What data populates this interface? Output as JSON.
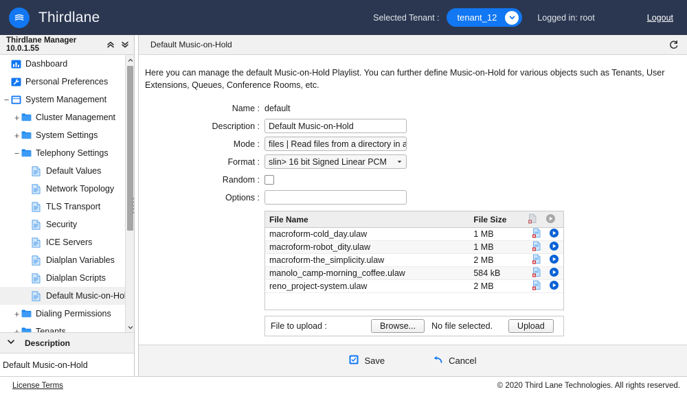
{
  "topbar": {
    "brand": "Thirdlane",
    "logo_icon": "thirdlane-waves-icon",
    "tenant_label": "Selected Tenant :",
    "tenant_value": "tenant_12",
    "tenant_caret_icon": "chevron-down-icon",
    "logged_in": "Logged in: root",
    "logout": "Logout",
    "bg_color": "#2b3750",
    "accent_color": "#1277f2"
  },
  "sidebar": {
    "title": "Thirdlane Manager 10.0.1.55",
    "collapse_all_icon": "double-chevron-up-icon",
    "expand_all_icon": "double-chevron-down-icon",
    "scroll_up_icon": "chevron-up-icon",
    "scroll_down_icon": "chevron-down-icon",
    "items": [
      {
        "label": "Dashboard",
        "icon": "dashboard-icon",
        "indent": 0,
        "twisty": "",
        "selected": false
      },
      {
        "label": "Personal Preferences",
        "icon": "wrench-icon",
        "indent": 0,
        "twisty": "",
        "selected": false
      },
      {
        "label": "System Management",
        "icon": "window-icon",
        "indent": 0,
        "twisty": "minus",
        "selected": false
      },
      {
        "label": "Cluster Management",
        "icon": "folder-icon",
        "indent": 1,
        "twisty": "plus",
        "selected": false
      },
      {
        "label": "System Settings",
        "icon": "folder-icon",
        "indent": 1,
        "twisty": "plus",
        "selected": false
      },
      {
        "label": "Telephony Settings",
        "icon": "folder-icon",
        "indent": 1,
        "twisty": "minus",
        "selected": false
      },
      {
        "label": "Default Values",
        "icon": "page-icon",
        "indent": 2,
        "twisty": "",
        "selected": false
      },
      {
        "label": "Network Topology",
        "icon": "page-icon",
        "indent": 2,
        "twisty": "",
        "selected": false
      },
      {
        "label": "TLS Transport",
        "icon": "page-icon",
        "indent": 2,
        "twisty": "",
        "selected": false
      },
      {
        "label": "Security",
        "icon": "page-icon",
        "indent": 2,
        "twisty": "",
        "selected": false
      },
      {
        "label": "ICE Servers",
        "icon": "page-icon",
        "indent": 2,
        "twisty": "",
        "selected": false
      },
      {
        "label": "Dialplan Variables",
        "icon": "page-icon",
        "indent": 2,
        "twisty": "",
        "selected": false
      },
      {
        "label": "Dialplan Scripts",
        "icon": "page-icon",
        "indent": 2,
        "twisty": "",
        "selected": false
      },
      {
        "label": "Default Music-on-Hold",
        "icon": "page-icon",
        "indent": 2,
        "twisty": "",
        "selected": true
      },
      {
        "label": "Dialing Permissions",
        "icon": "folder-icon",
        "indent": 1,
        "twisty": "plus",
        "selected": false
      },
      {
        "label": "Tenants",
        "icon": "folder-icon",
        "indent": 1,
        "twisty": "plus",
        "selected": false
      }
    ],
    "description_panel": {
      "header": "Description",
      "collapse_icon": "chevron-down-icon",
      "text": "Default Music-on-Hold"
    }
  },
  "main": {
    "header_title": "Default Music-on-Hold",
    "refresh_icon": "refresh-icon",
    "intro": "Here you can manage the default Music-on-Hold Playlist. You can further define Music-on-Hold for various objects such as Tenants, User Extensions, Queues, Conference Rooms, etc.",
    "form": {
      "name_label": "Name :",
      "name_value": "default",
      "description_label": "Description :",
      "description_value": "Default Music-on-Hold",
      "mode_label": "Mode :",
      "mode_value": "files | Read files from a directory in an...",
      "format_label": "Format :",
      "format_value": "slin> 16 bit Signed Linear PCM",
      "random_label": "Random :",
      "random_checked": false,
      "options_label": "Options :",
      "options_value": "",
      "dropdown_caret_icon": "caret-down-icon"
    },
    "table": {
      "columns": [
        "File Name",
        "File Size"
      ],
      "header_delete_icon": "delete-file-icon-disabled",
      "header_play_icon": "play-icon-disabled",
      "row_delete_icon": "delete-file-icon",
      "row_play_icon": "play-icon",
      "rows": [
        {
          "name": "macroform-cold_day.ulaw",
          "size": "1 MB"
        },
        {
          "name": "macroform-robot_dity.ulaw",
          "size": "1 MB"
        },
        {
          "name": "macroform-the_simplicity.ulaw",
          "size": "2 MB"
        },
        {
          "name": "manolo_camp-morning_coffee.ulaw",
          "size": "584 kB"
        },
        {
          "name": "reno_project-system.ulaw",
          "size": "2 MB"
        }
      ]
    },
    "upload": {
      "label": "File to upload :",
      "browse_button": "Browse...",
      "file_status": "No file selected.",
      "upload_button": "Upload"
    },
    "actions": {
      "save_label": "Save",
      "save_icon": "checkbox-icon",
      "cancel_label": "Cancel",
      "cancel_icon": "undo-arrow-icon"
    }
  },
  "footer": {
    "license_terms": "License Terms",
    "copyright": "© 2020 Third Lane Technologies. All rights reserved."
  }
}
